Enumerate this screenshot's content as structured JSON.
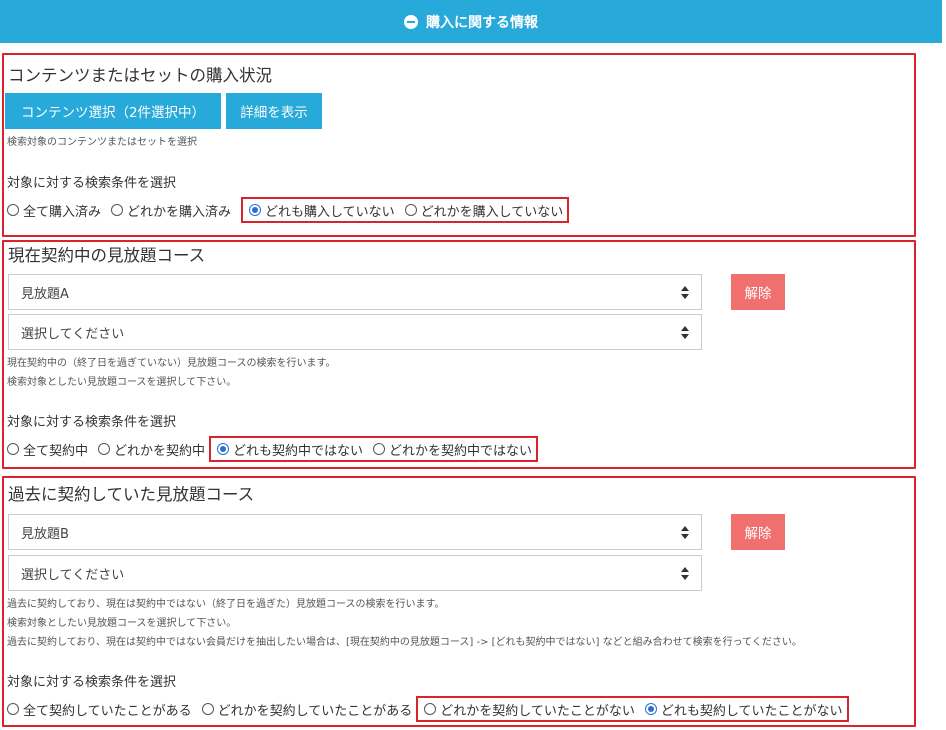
{
  "header": {
    "title": "購入に関する情報",
    "icon": "minus-circle-icon",
    "color": "#27a9d9"
  },
  "section1": {
    "title": "コンテンツまたはセットの購入状況",
    "select_button": "コンテンツ選択（2件選択中）",
    "detail_button": "詳細を表示",
    "help": "検索対象のコンテンツまたはセットを選択",
    "condition_label": "対象に対する検索条件を選択",
    "options": [
      {
        "label": "全て購入済み",
        "checked": false
      },
      {
        "label": "どれかを購入済み",
        "checked": false
      },
      {
        "label": "どれも購入していない",
        "checked": true
      },
      {
        "label": "どれかを購入していない",
        "checked": false
      }
    ]
  },
  "section2": {
    "title": "現在契約中の見放題コース",
    "select1_value": "見放題A",
    "select2_value": "選択してください",
    "clear_button": "解除",
    "help1": "現在契約中の（終了日を過ぎていない）見放題コースの検索を行います。",
    "help2": "検索対象としたい見放題コースを選択して下さい。",
    "condition_label": "対象に対する検索条件を選択",
    "options": [
      {
        "label": "全て契約中",
        "checked": false
      },
      {
        "label": "どれかを契約中",
        "checked": false
      },
      {
        "label": "どれも契約中ではない",
        "checked": true
      },
      {
        "label": "どれかを契約中ではない",
        "checked": false
      }
    ]
  },
  "section3": {
    "title": "過去に契約していた見放題コース",
    "select1_value": "見放題B",
    "select2_value": "選択してください",
    "clear_button": "解除",
    "help1": "過去に契約しており、現在は契約中ではない（終了日を過ぎた）見放題コースの検索を行います。",
    "help2": "検索対象としたい見放題コースを選択して下さい。",
    "help3": "過去に契約しており、現在は契約中ではない会員だけを抽出したい場合は、[現在契約中の見放題コース] -> [どれも契約中ではない] などと組み合わせて検索を行ってください。",
    "condition_label": "対象に対する検索条件を選択",
    "options": [
      {
        "label": "全て契約していたことがある",
        "checked": false
      },
      {
        "label": "どれかを契約していたことがある",
        "checked": false
      },
      {
        "label": "どれかを契約していたことがない",
        "checked": false
      },
      {
        "label": "どれも契約していたことがない",
        "checked": true
      }
    ]
  },
  "colors": {
    "accent": "#27a9d9",
    "highlight_border": "#d9232d",
    "clear_button": "#f07070",
    "radio_checked": "#2b6fd6"
  }
}
